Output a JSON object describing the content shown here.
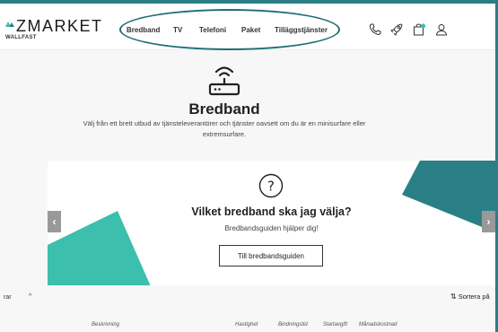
{
  "brand": {
    "logo_text": "ZMARKET",
    "logo_sub": "WALLFAST"
  },
  "nav": {
    "bredband": "Bredband",
    "tv": "TV",
    "telefoni": "Telefoni",
    "paket": "Paket",
    "tillagg": "Tilläggstjänster"
  },
  "header_icons": [
    "phone-icon",
    "rocket-icon",
    "cart-icon",
    "user-icon"
  ],
  "hero": {
    "title": "Bredband",
    "description": "Välj från ett brett utbud av tjänsteleverantörer och tjänster oavsett om du är en minisurfare eller extremsurfare."
  },
  "banner": {
    "question": "Vilket bredband ska jag välja?",
    "subtitle": "Bredbandsguiden hjälper dig!",
    "button": "Till bredbandsguiden",
    "prev": "‹",
    "next": "›"
  },
  "filter": {
    "label": "rar",
    "toggle": "^"
  },
  "sort": {
    "label": "Sortera på",
    "icon": "⇅"
  },
  "columns": [
    "Beskrivning",
    "Hastighet",
    "Bindningstid",
    "Startavgift",
    "Månadskostnad"
  ],
  "colors": {
    "accent": "#2a7f86",
    "accent_light": "#3cbfad",
    "accent_dark": "#1f6f75"
  }
}
